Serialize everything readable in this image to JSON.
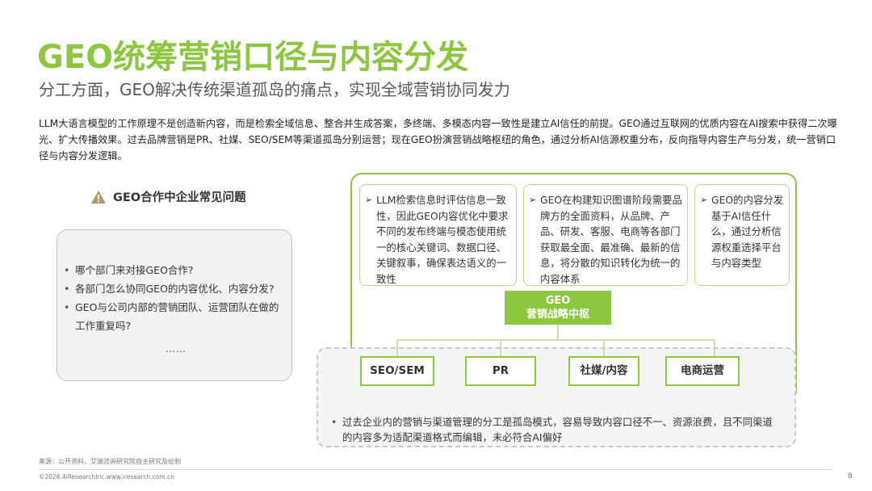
{
  "title": "GEO统筹营销口径与内容分发",
  "subtitle": "分工方面，GEO解决传统渠道孤岛的痛点，实现全域营销协同发力",
  "intro": "LLM大语言模型的工作原理不是创造新内容，而是检索全域信息、整合并生成答案，多终端、多模态内容一致性是建立AI信任的前提。GEO通过互联网的优质内容在AI搜索中获得二次曝光、扩大传播效果。过去品牌营销是PR、社媒、SEO/SEM等渠道孤岛分别运营；现在GEO扮演营销战略枢纽的角色，通过分析AI信源权重分布，反向指导内容生产与分发，统一营销口径与内容分发逻辑。",
  "faq": {
    "icon": "warning-icon",
    "title": "GEO合作中企业常见问题",
    "items": [
      "哪个部门来对接GEO合作?",
      "各部门怎么协同GEO的内容优化、内容分发?",
      "GEO与公司内部的营销团队、运营团队在做的工作重复吗?"
    ],
    "ellipsis": "……"
  },
  "cards": [
    "LLM检索信息时评估信息一致性，因此GEO内容优化中要求不同的发布终端与模态使用统一的核心关键词、数据口径、关键叙事，确保表达语义的一致性",
    "GEO在构建知识图谱阶段需要品牌方的全面资料，从品牌、产品、研发、客服、电商等各部门获取最全面、最准确、最新的信息，将分散的知识转化为统一的内容体系",
    "GEO的内容分发基于AI信任什么，通过分析信源权重选择平台与内容类型"
  ],
  "hub": {
    "line1": "GEO",
    "line2": "营销战略中枢"
  },
  "channels": [
    "SEO/SEM",
    "PR",
    "社媒/内容",
    "电商运营"
  ],
  "note": "过去企业内的营销与渠道管理的分工是孤岛模式，容易导致内容口径不一、资源浪费，且不同渠道的内容多为适配渠道格式而编辑，未必符合AI偏好",
  "source": "来源：公开资料，艾瑞咨询研究院自主研究及绘制",
  "copyright": "©2026.4iResearchInc.www.iresearch.com.cn",
  "page_number": "8",
  "colors": {
    "accent": "#8dc63f",
    "light_accent": "#b6d98c",
    "warning": "#b09a6a"
  }
}
